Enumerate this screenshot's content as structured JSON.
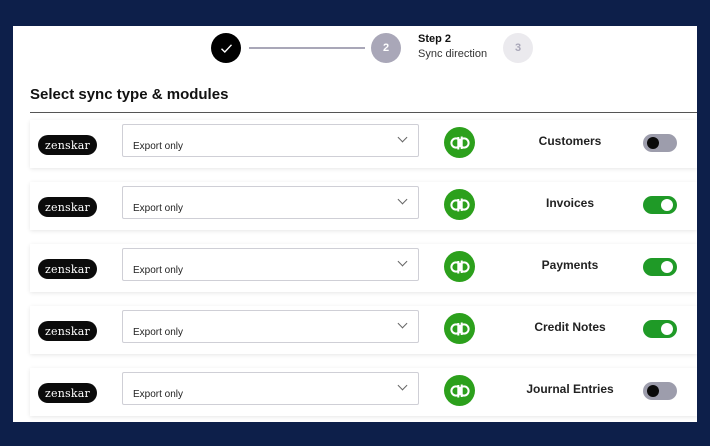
{
  "stepper": {
    "step1_icon": "check-icon",
    "step2_number": "2",
    "step3_number": "3",
    "current_title": "Step 2",
    "current_subtitle": "Sync direction"
  },
  "section": {
    "title": "Select sync type & modules"
  },
  "colors": {
    "accent_green": "#1f9a27",
    "qb_green": "#2ca01c",
    "toggle_off": "#9d9dac",
    "background": "#0d1f4a"
  },
  "rows": [
    {
      "logo": "zenskar",
      "sync_type": "Export only",
      "target_icon": "quickbooks-icon",
      "module": "Customers",
      "enabled": false
    },
    {
      "logo": "zenskar",
      "sync_type": "Export only",
      "target_icon": "quickbooks-icon",
      "module": "Invoices",
      "enabled": true
    },
    {
      "logo": "zenskar",
      "sync_type": "Export only",
      "target_icon": "quickbooks-icon",
      "module": "Payments",
      "enabled": true
    },
    {
      "logo": "zenskar",
      "sync_type": "Export only",
      "target_icon": "quickbooks-icon",
      "module": "Credit Notes",
      "enabled": true
    },
    {
      "logo": "zenskar",
      "sync_type": "Export only",
      "target_icon": "quickbooks-icon",
      "module": "Journal Entries",
      "enabled": false
    }
  ]
}
